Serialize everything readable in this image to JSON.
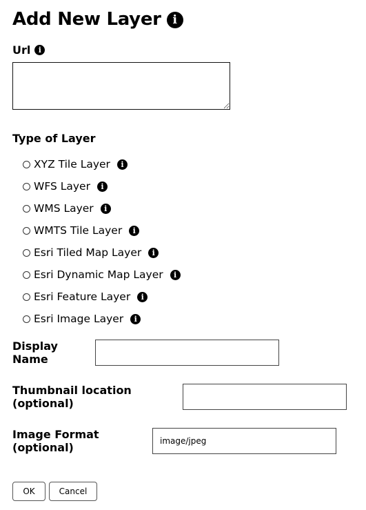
{
  "title": "Add New Layer",
  "url": {
    "label": "Url",
    "value": ""
  },
  "layer_type": {
    "label": "Type of Layer",
    "options": [
      {
        "label": "XYZ Tile Layer",
        "selected": false
      },
      {
        "label": "WFS Layer",
        "selected": false
      },
      {
        "label": "WMS Layer",
        "selected": false
      },
      {
        "label": "WMTS Tile Layer",
        "selected": false
      },
      {
        "label": "Esri Tiled Map Layer",
        "selected": false
      },
      {
        "label": "Esri Dynamic Map Layer",
        "selected": false
      },
      {
        "label": "Esri Feature Layer",
        "selected": false
      },
      {
        "label": "Esri Image Layer",
        "selected": false
      }
    ]
  },
  "display_name": {
    "label": "Display Name",
    "value": ""
  },
  "thumbnail": {
    "label": "Thumbnail location (optional)",
    "value": ""
  },
  "image_format": {
    "label": "Image Format (optional)",
    "value": "image/jpeg"
  },
  "buttons": {
    "ok_label": "OK",
    "cancel_label": "Cancel"
  },
  "icons": {
    "info": "info-circle-icon"
  },
  "colors": {
    "text": "#000000",
    "background": "#ffffff",
    "border": "#444444"
  }
}
